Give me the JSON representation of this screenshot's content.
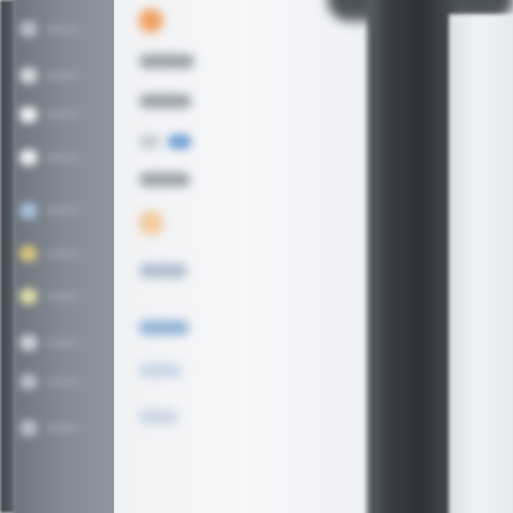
{
  "colors": {
    "sidebar": "#848b94",
    "panel": "#f3f4f6",
    "device_frame": "#2f3338",
    "accent_orange": "#f0a060",
    "accent_blue": "#7aa6d6",
    "accent_yellow": "#d9c67a"
  },
  "sidebar": {
    "items": [
      {
        "icon": "app-icon",
        "color": "#b9bfc7"
      },
      {
        "icon": "app-icon",
        "color": "#d8dce2"
      },
      {
        "icon": "app-icon",
        "color": "#f2f4f7"
      },
      {
        "icon": "app-icon",
        "color": "#f2f4f7"
      },
      {
        "icon": "app-icon",
        "color": "#a9c3de"
      },
      {
        "icon": "app-icon",
        "color": "#d9c67a"
      },
      {
        "icon": "app-icon",
        "color": "#dfe0a8"
      },
      {
        "icon": "app-icon",
        "color": "#cdd2d9"
      },
      {
        "icon": "app-icon",
        "color": "#b9bfc7"
      },
      {
        "icon": "app-icon",
        "color": "#b9bfc7"
      }
    ]
  },
  "list": {
    "rows": [
      {
        "kind": "icon",
        "color": "#f0a060"
      },
      {
        "kind": "bar",
        "color": "#9aa1aa"
      },
      {
        "kind": "bar",
        "color": "#9aa1aa"
      },
      {
        "kind": "bar-chip",
        "color": "#c5cbd2",
        "chip_color": "#7aa6d6"
      },
      {
        "kind": "bar",
        "color": "#9aa1aa"
      },
      {
        "kind": "icon",
        "color": "#f2c99a"
      },
      {
        "kind": "bar",
        "color": "#aebccd"
      },
      {
        "kind": "bar",
        "color": "#8fb1d6"
      },
      {
        "kind": "bar",
        "color": "#c9d6e4"
      },
      {
        "kind": "bar",
        "color": "#c9d6e4"
      }
    ]
  }
}
